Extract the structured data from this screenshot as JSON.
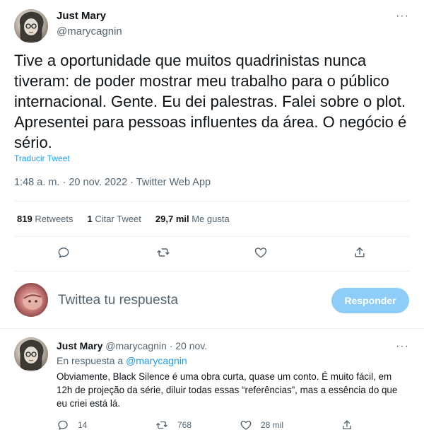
{
  "tweet": {
    "author_name": "Just Mary",
    "author_handle": "@marycagnin",
    "more": "···",
    "text": "Tive a oportunidade que muitos quadrinistas nunca tiveram: de poder mostrar meu trabalho para o público internacional. Gente. Eu dei palestras. Falei sobre o plot. Apresentei para pessoas influentes da área. O negócio é sério.",
    "translate": "Traducir Tweet",
    "timestamp": "1:48 a. m. · 20 nov. 2022 · Twitter Web App",
    "stats": {
      "retweets_count": "819",
      "retweets_label": "Retweets",
      "quotes_count": "1",
      "quotes_label": "Citar Tweet",
      "likes_count": "29,7 mil",
      "likes_label": "Me gusta"
    }
  },
  "compose": {
    "placeholder": "Twittea tu respuesta",
    "button": "Responder"
  },
  "reply": {
    "author_name": "Just Mary",
    "author_handle": "@marycagnin",
    "date": "· 20 nov.",
    "more": "···",
    "in_reply_to_prefix": "En respuesta a",
    "in_reply_to_handle": "@marycagnin",
    "text": "Obviamente, Black Silence é uma obra curta, quase um conto. É muito fácil, em 12h de projeção da série, diluir todas essas “referências”, mas a essência do que eu criei está lá.",
    "replies": "14",
    "retweets": "768",
    "likes": "28 mil"
  },
  "colors": {
    "accent": "#1d9bf0",
    "reply_button_disabled": "#8ecdf8",
    "secondary_text": "#536471"
  },
  "icons": [
    "reply-icon",
    "retweet-icon",
    "like-icon",
    "share-icon",
    "more-icon"
  ]
}
